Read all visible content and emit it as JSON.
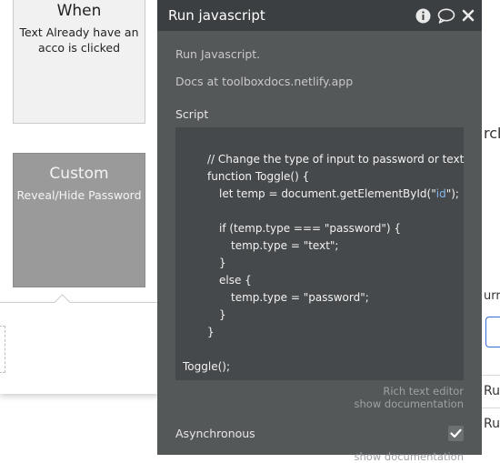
{
  "canvas": {
    "when_card": {
      "title": "When",
      "subtitle_line1": "Text Already have an",
      "subtitle_line2": "acco is clicked"
    },
    "custom_card": {
      "title": "Custom",
      "subtitle": "Reveal/Hide Password"
    }
  },
  "right_edge": {
    "search_fragment": "rch",
    "current_fragment": "urr",
    "row1_fragment": "Ru",
    "row2_fragment": "Ru"
  },
  "editor": {
    "title": "Run javascript",
    "header_icons": [
      "info-icon",
      "comment-icon",
      "close-icon"
    ],
    "description_line1": "Run Javascript.",
    "description_line2": "Docs at toolboxdocs.netlify.app",
    "script_label": "Script",
    "code": {
      "l1": "// Change the type of input to password or text",
      "l2": "function Toggle() {",
      "l3_pre": "let temp = document.getElementById(\"",
      "l3_str": "id",
      "l3_post": "\");",
      "l4": "if (temp.type === \"password\") {",
      "l5": "temp.type = \"text\";",
      "l6": "}",
      "l7": "else {",
      "l8": "temp.type = \"password\";",
      "l9": "}",
      "l10": "}",
      "l11": "Toggle();"
    },
    "rich_text_link": "Rich text editor",
    "show_documentation_1": "show documentation",
    "async_label": "Asynchronous",
    "async_checked": true,
    "show_documentation_2": "show documentation"
  },
  "colors": {
    "editor_bg": "#555859",
    "header_bg": "#3b3f41",
    "code_bg": "#46494b",
    "code_string": "#86b4ee",
    "custom_card_bg": "#9a9a9a"
  }
}
